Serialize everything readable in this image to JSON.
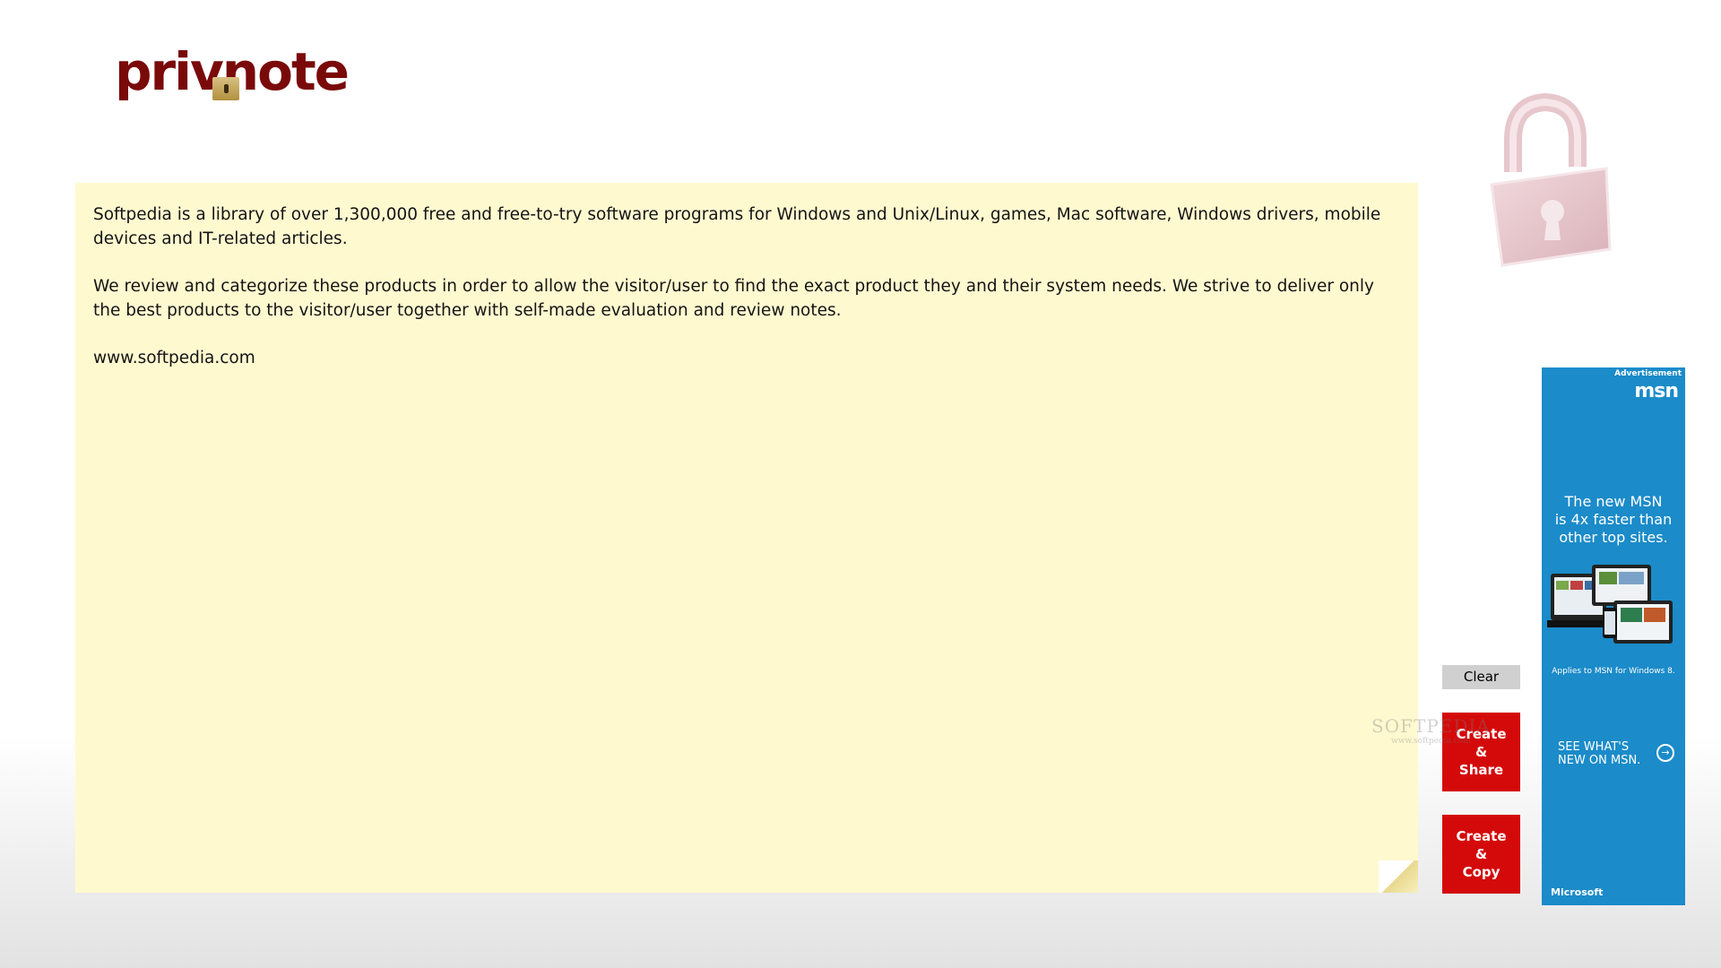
{
  "app": {
    "logo_text": "privnote"
  },
  "note": {
    "paragraphs": [
      "Softpedia is a library of over 1,300,000 free and free-to-try software programs for Windows and Unix/Linux, games, Mac software, Windows drivers, mobile devices and IT-related articles.",
      "We review and categorize these products in order to allow the visitor/user to find the exact product they and their system needs. We strive to deliver only the best products to the visitor/user together with self-made evaluation and review notes.",
      "www.softpedia.com"
    ]
  },
  "buttons": {
    "clear": "Clear",
    "create_share": [
      "Create",
      "&",
      "Share"
    ],
    "create_copy": [
      "Create",
      "&",
      "Copy"
    ]
  },
  "watermark": {
    "main": "SOFTPEDIA",
    "sub": "www.softpedia.com"
  },
  "ad": {
    "label": "Advertisement",
    "brand_logo": "msn",
    "headline": [
      "The new MSN",
      "is 4x faster than",
      "other top sites."
    ],
    "applies": "Applies to MSN for Windows 8.",
    "cta": [
      "SEE WHAT'S",
      "NEW ON MSN."
    ],
    "footer": "Microsoft",
    "background_color": "#1b8bc9"
  },
  "colors": {
    "note_background": "#fff9d0",
    "accent_red": "#d40a0a",
    "logo_color": "#7a0a0a"
  }
}
